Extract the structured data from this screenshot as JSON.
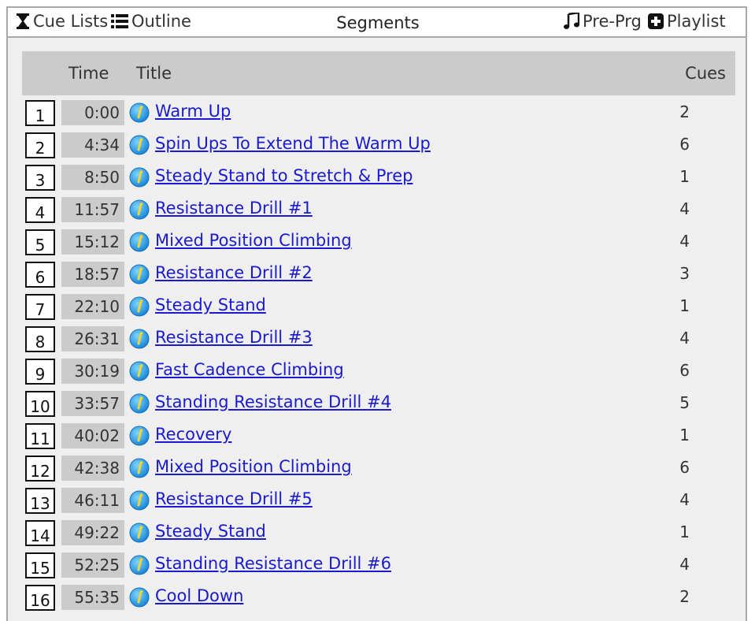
{
  "nav": {
    "cue_lists": "Cue Lists",
    "outline": "Outline",
    "title": "Segments",
    "pre_prg": "Pre-Prg",
    "playlist": "Playlist"
  },
  "table": {
    "headers": {
      "time": "Time",
      "title": "Title",
      "cues": "Cues"
    },
    "rows": [
      {
        "num": "1",
        "time": "0:00",
        "title": "Warm Up",
        "cues": "2"
      },
      {
        "num": "2",
        "time": "4:34",
        "title": "Spin Ups To Extend The Warm Up",
        "cues": "6"
      },
      {
        "num": "3",
        "time": "8:50",
        "title": "Steady Stand to Stretch & Prep",
        "cues": "1"
      },
      {
        "num": "4",
        "time": "11:57",
        "title": "Resistance Drill #1",
        "cues": "4"
      },
      {
        "num": "5",
        "time": "15:12",
        "title": "Mixed Position Climbing",
        "cues": "4"
      },
      {
        "num": "6",
        "time": "18:57",
        "title": "Resistance Drill #2",
        "cues": "3"
      },
      {
        "num": "7",
        "time": "22:10",
        "title": "Steady Stand",
        "cues": "1"
      },
      {
        "num": "8",
        "time": "26:31",
        "title": "Resistance Drill #3",
        "cues": "4"
      },
      {
        "num": "9",
        "time": "30:19",
        "title": "Fast Cadence Climbing",
        "cues": "6"
      },
      {
        "num": "10",
        "time": "33:57",
        "title": "Standing Resistance Drill #4",
        "cues": "5"
      },
      {
        "num": "11",
        "time": "40:02",
        "title": "Recovery",
        "cues": "1"
      },
      {
        "num": "12",
        "time": "42:38",
        "title": "Mixed Position Climbing",
        "cues": "6"
      },
      {
        "num": "13",
        "time": "46:11",
        "title": "Resistance Drill #5",
        "cues": "4"
      },
      {
        "num": "14",
        "time": "49:22",
        "title": "Steady Stand",
        "cues": "1"
      },
      {
        "num": "15",
        "time": "52:25",
        "title": "Standing Resistance Drill #6",
        "cues": "4"
      },
      {
        "num": "16",
        "time": "55:35",
        "title": "Cool Down",
        "cues": "2"
      }
    ]
  },
  "icons": {
    "cue_lists": "hourglass-icon",
    "outline": "list-icon",
    "pre_prg": "music-note-icon",
    "playlist": "plus-square-icon",
    "row_info": "info-icon"
  },
  "colors": {
    "link": "#1a1ad0",
    "header_bg": "#cbcbcb",
    "panel_bg": "#efefef",
    "info_icon": "#2a9ee8"
  }
}
